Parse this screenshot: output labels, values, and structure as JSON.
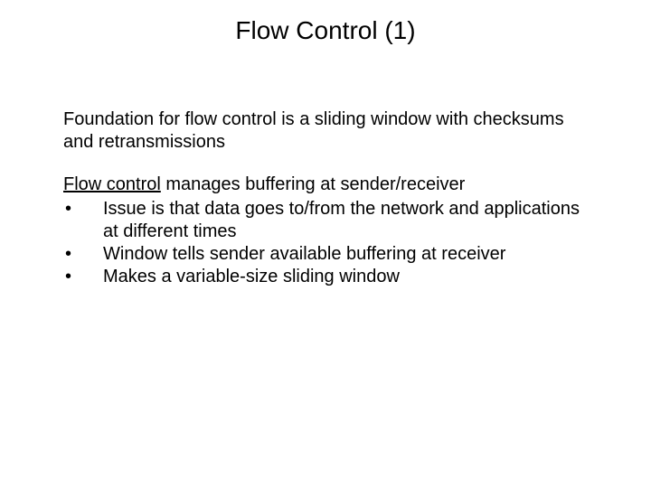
{
  "title": "Flow Control (1)",
  "intro": "Foundation for flow control is a sliding window with checksums and retransmissions",
  "lead_underlined": "Flow control",
  "lead_rest": " manages buffering at sender/receiver",
  "bullets": [
    "Issue is that data goes to/from the network and applications at different times",
    "Window tells sender available buffering at receiver",
    "Makes a variable-size sliding window"
  ],
  "bullet_mark": "•"
}
